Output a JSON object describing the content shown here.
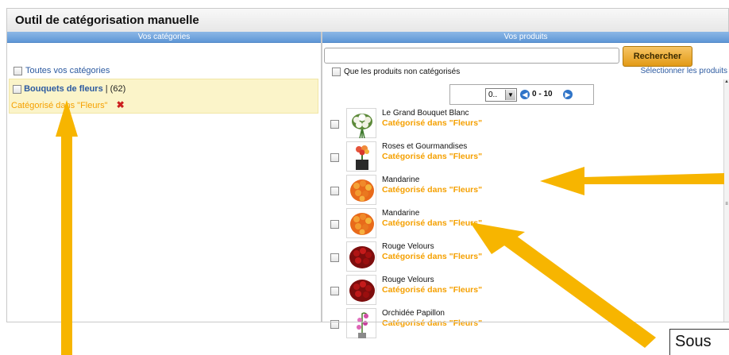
{
  "window": {
    "title": "Outil de catégorisation manuelle"
  },
  "left_panel": {
    "header": "Vos catégories",
    "all_categories": "Toutes vos catégories",
    "selected_category": {
      "name": "Bouquets de fleurs",
      "separator": " | ",
      "count": "(62)",
      "status": "Catégorisé dans \"Fleurs\"",
      "delete_icon": "✖"
    }
  },
  "right_panel": {
    "header": "Vos produits",
    "search": {
      "value": "",
      "button": "Rechercher"
    },
    "filter_uncategorized": "Que les produits non catégorisés",
    "select_products": "Sélectionner les produits",
    "pager": {
      "page_select": "0..",
      "range": "0 - 10",
      "prev_icon": "◀",
      "next_icon": "▶"
    },
    "products": [
      {
        "name": "Le Grand Bouquet Blanc",
        "category": "Catégorisé dans \"Fleurs\"",
        "image": "white-bouquet"
      },
      {
        "name": "Roses et Gourmandises",
        "category": "Catégorisé dans \"Fleurs\"",
        "image": "roses-gift-box"
      },
      {
        "name": "Mandarine",
        "category": "Catégorisé dans \"Fleurs\"",
        "image": "orange-roses"
      },
      {
        "name": "Mandarine",
        "category": "Catégorisé dans \"Fleurs\"",
        "image": "orange-roses"
      },
      {
        "name": "Rouge Velours",
        "category": "Catégorisé dans \"Fleurs\"",
        "image": "red-roses"
      },
      {
        "name": "Rouge Velours",
        "category": "Catégorisé dans \"Fleurs\"",
        "image": "red-roses"
      },
      {
        "name": "Orchidée Papillon",
        "category": "Catégorisé dans \"Fleurs\"",
        "image": "orchid"
      }
    ]
  },
  "annotation": {
    "callout_text": "Sous",
    "arrow_color": "#f7b500"
  },
  "colors": {
    "accent_orange": "#f5a000",
    "link_blue": "#2c5aa0",
    "header_blue": "#5f97d6",
    "category_bg": "#fbf4c9"
  }
}
